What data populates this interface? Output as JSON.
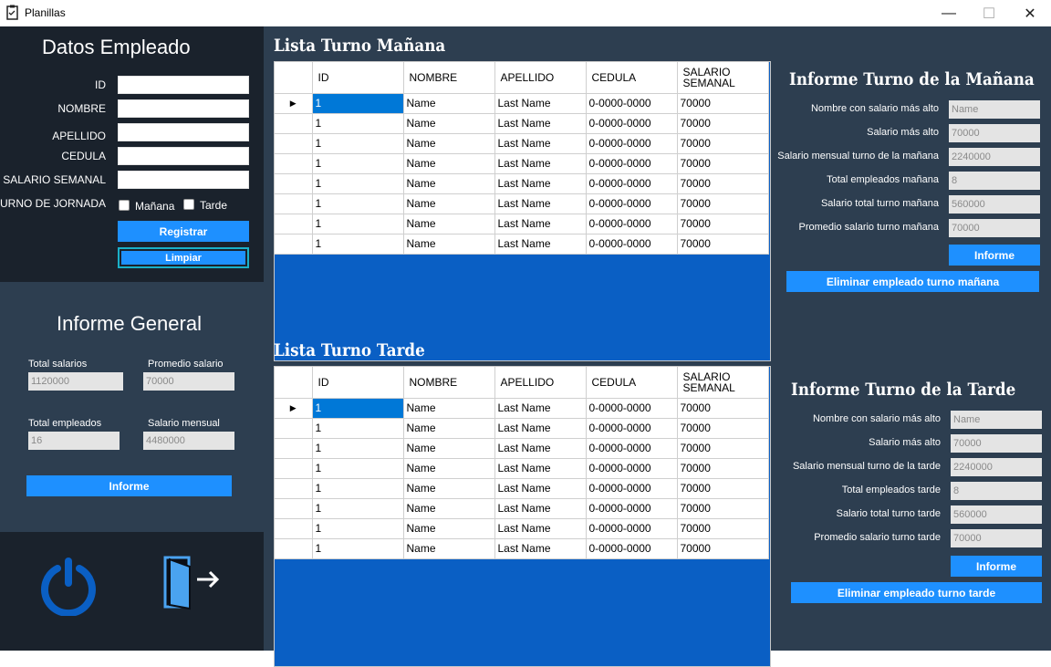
{
  "window": {
    "title": "Planillas",
    "minimize": "—",
    "maximize": "☐",
    "close": "✕"
  },
  "datos": {
    "title": "Datos Empleado",
    "labels": {
      "id": "ID",
      "nombre": "NOMBRE",
      "apellido": "APELLIDO",
      "cedula": "CEDULA",
      "salario": "SALARIO SEMANAL",
      "turno": "TURNO DE JORNADA"
    },
    "values": {
      "id": "",
      "nombre": "",
      "apellido": "",
      "cedula": "",
      "salario": ""
    },
    "manana": "Mañana",
    "tarde": "Tarde",
    "registrar": "Registrar",
    "limpiar": "Limpiar"
  },
  "general": {
    "title": "Informe General",
    "total_salarios_label": "Total salarios",
    "total_salarios": "1120000",
    "promedio_label": "Promedio salario",
    "promedio": "70000",
    "total_empleados_label": "Total empleados",
    "total_empleados": "16",
    "mensual_label": "Salario mensual",
    "mensual": "4480000",
    "informe": "Informe"
  },
  "grid_columns": [
    "ID",
    "NOMBRE",
    "APELLIDO",
    "CEDULA",
    "SALARIO\nSEMANAL"
  ],
  "manana_list": {
    "title": "Lista Turno Mañana",
    "rows": [
      [
        "1",
        "Name",
        "Last Name",
        "0-0000-0000",
        "70000"
      ],
      [
        "1",
        "Name",
        "Last Name",
        "0-0000-0000",
        "70000"
      ],
      [
        "1",
        "Name",
        "Last Name",
        "0-0000-0000",
        "70000"
      ],
      [
        "1",
        "Name",
        "Last Name",
        "0-0000-0000",
        "70000"
      ],
      [
        "1",
        "Name",
        "Last Name",
        "0-0000-0000",
        "70000"
      ],
      [
        "1",
        "Name",
        "Last Name",
        "0-0000-0000",
        "70000"
      ],
      [
        "1",
        "Name",
        "Last Name",
        "0-0000-0000",
        "70000"
      ],
      [
        "1",
        "Name",
        "Last Name",
        "0-0000-0000",
        "70000"
      ]
    ]
  },
  "tarde_list": {
    "title": "Lista Turno Tarde",
    "rows": [
      [
        "1",
        "Name",
        "Last Name",
        "0-0000-0000",
        "70000"
      ],
      [
        "1",
        "Name",
        "Last Name",
        "0-0000-0000",
        "70000"
      ],
      [
        "1",
        "Name",
        "Last Name",
        "0-0000-0000",
        "70000"
      ],
      [
        "1",
        "Name",
        "Last Name",
        "0-0000-0000",
        "70000"
      ],
      [
        "1",
        "Name",
        "Last Name",
        "0-0000-0000",
        "70000"
      ],
      [
        "1",
        "Name",
        "Last Name",
        "0-0000-0000",
        "70000"
      ],
      [
        "1",
        "Name",
        "Last Name",
        "0-0000-0000",
        "70000"
      ],
      [
        "1",
        "Name",
        "Last Name",
        "0-0000-0000",
        "70000"
      ]
    ]
  },
  "informe_manana": {
    "title": "Informe Turno de la Mañana",
    "labels": [
      "Nombre con salario más alto",
      "Salario más alto",
      "Salario mensual turno de la mañana",
      "Total empleados mañana",
      "Salario total turno mañana",
      "Promedio salario turno mañana"
    ],
    "values": [
      "Name",
      "70000",
      "2240000",
      "8",
      "560000",
      "70000"
    ],
    "informe": "Informe",
    "eliminar": "Eliminar empleado turno mañana"
  },
  "informe_tarde": {
    "title": "Informe Turno de la Tarde",
    "labels": [
      "Nombre con salario más alto",
      "Salario más alto",
      "Salario mensual turno de la tarde",
      "Total empleados tarde",
      "Salario total turno tarde",
      "Promedio salario turno tarde"
    ],
    "values": [
      "Name",
      "70000",
      "2240000",
      "8",
      "560000",
      "70000"
    ],
    "informe": "Informe",
    "eliminar": "Eliminar empleado turno tarde"
  },
  "icons": {
    "power": "power-icon",
    "exit": "exit-door-icon"
  },
  "colors": {
    "accent": "#1e90ff",
    "grid_bg": "#0a5fc4",
    "panel_dark": "#1a222c",
    "panel": "#2d3e50",
    "icon_blue": "#0a5fc4"
  }
}
